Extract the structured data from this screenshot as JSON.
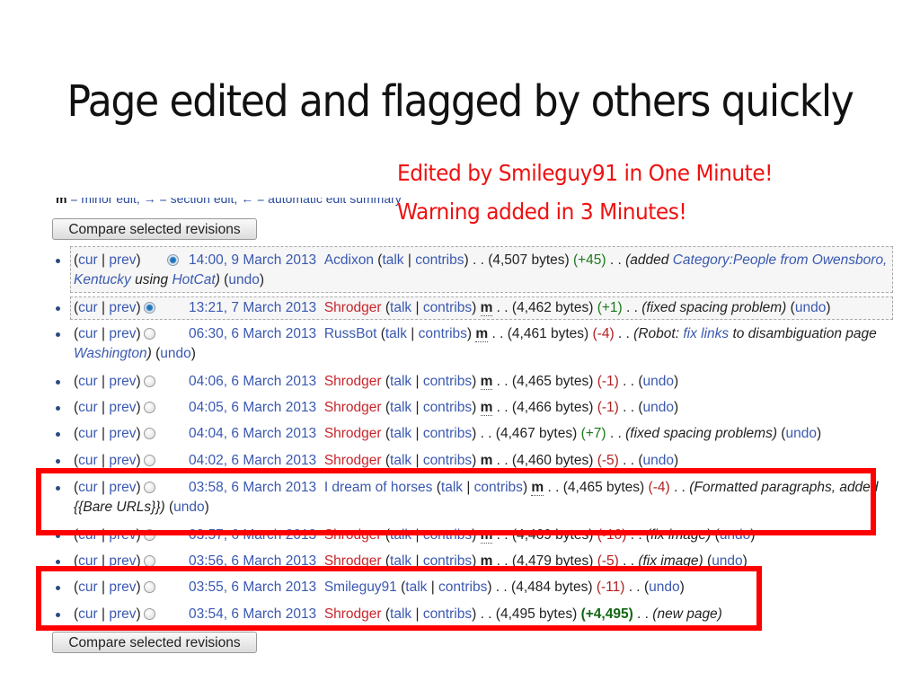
{
  "slide": {
    "title": "Page edited and flagged by others quickly",
    "annotations": [
      "Edited by Smileguy91 in One Minute!",
      "Warning added in 3  Minutes!"
    ],
    "accent_color": "#ff0000"
  },
  "history": {
    "legend": {
      "minor_abbr": "m",
      "text": " = minor edit, → = section edit, ← = automatic edit summary"
    },
    "compare_button_label": "Compare selected revisions",
    "revisions": [
      {
        "cur": "cur",
        "prev": "prev",
        "selected": true,
        "date": "14:00, 9 March 2013",
        "user": "Acdixon",
        "user_style": "blue",
        "talk": "talk",
        "contribs": "contribs",
        "minor": false,
        "size": "(4,507 bytes)",
        "diff": "(+45)",
        "diff_sign": "pos",
        "comment_pre": "(added ",
        "comment_link": "Category:People from Owensboro, Kentucky",
        "comment_post": " using ",
        "comment_link2": "HotCat",
        "comment_end": ")",
        "undo": "undo"
      },
      {
        "cur": "cur",
        "prev": "prev",
        "selected": true,
        "date": "13:21, 7 March 2013",
        "user": "Shrodger",
        "user_style": "red",
        "talk": "talk",
        "contribs": "contribs",
        "minor": true,
        "size": "(4,462 bytes)",
        "diff": "(+1)",
        "diff_sign": "pos",
        "comment": "(fixed spacing problem)",
        "undo": "undo"
      },
      {
        "cur": "cur",
        "prev": "prev",
        "selected": false,
        "date": "06:30, 6 March 2013",
        "user": "RussBot",
        "user_style": "blue",
        "talk": "talk",
        "contribs": "contribs",
        "minor": true,
        "size": "(4,461 bytes)",
        "diff": "(-4)",
        "diff_sign": "neg",
        "comment_pre": "(Robot: ",
        "comment_link": "fix links",
        "comment_post": " to disambiguation page ",
        "comment_link2": "Washington",
        "comment_end": ")",
        "undo": "undo"
      },
      {
        "cur": "cur",
        "prev": "prev",
        "selected": false,
        "date": "04:06, 6 March 2013",
        "user": "Shrodger",
        "user_style": "red",
        "talk": "talk",
        "contribs": "contribs",
        "minor": true,
        "size": "(4,465 bytes)",
        "diff": "(-1)",
        "diff_sign": "neg",
        "undo": "undo"
      },
      {
        "cur": "cur",
        "prev": "prev",
        "selected": false,
        "date": "04:05, 6 March 2013",
        "user": "Shrodger",
        "user_style": "red",
        "talk": "talk",
        "contribs": "contribs",
        "minor": true,
        "size": "(4,466 bytes)",
        "diff": "(-1)",
        "diff_sign": "neg",
        "undo": "undo"
      },
      {
        "cur": "cur",
        "prev": "prev",
        "selected": false,
        "date": "04:04, 6 March 2013",
        "user": "Shrodger",
        "user_style": "red",
        "talk": "talk",
        "contribs": "contribs",
        "minor": false,
        "size": "(4,467 bytes)",
        "diff": "(+7)",
        "diff_sign": "pos",
        "comment": "(fixed spacing problems)",
        "undo": "undo"
      },
      {
        "cur": "cur",
        "prev": "prev",
        "selected": false,
        "date": "04:02, 6 March 2013",
        "user": "Shrodger",
        "user_style": "red",
        "talk": "talk",
        "contribs": "contribs",
        "minor": true,
        "size": "(4,460 bytes)",
        "diff": "(-5)",
        "diff_sign": "neg",
        "undo": "undo"
      },
      {
        "cur": "cur",
        "prev": "prev",
        "selected": false,
        "date": "03:58, 6 March 2013",
        "user": "I dream of horses",
        "user_style": "blue",
        "talk": "talk",
        "contribs": "contribs",
        "minor": true,
        "size": "(4,465 bytes)",
        "diff": "(-4)",
        "diff_sign": "neg",
        "comment": "(Formatted paragraphs, added {{Bare URLs}})",
        "undo": "undo"
      },
      {
        "cur": "cur",
        "prev": "prev",
        "selected": false,
        "date": "03:57, 6 March 2013",
        "user": "Shrodger",
        "user_style": "red",
        "talk": "talk",
        "contribs": "contribs",
        "minor": true,
        "size": "(4,469 bytes)",
        "diff": "(-10)",
        "diff_sign": "neg",
        "comment": "(fix image)",
        "undo": "undo"
      },
      {
        "cur": "cur",
        "prev": "prev",
        "selected": false,
        "date": "03:56, 6 March 2013",
        "user": "Shrodger",
        "user_style": "red",
        "talk": "talk",
        "contribs": "contribs",
        "minor": true,
        "size": "(4,479 bytes)",
        "diff": "(-5)",
        "diff_sign": "neg",
        "comment": "(fix image)",
        "undo": "undo"
      },
      {
        "cur": "cur",
        "prev": "prev",
        "selected": false,
        "date": "03:55, 6 March 2013",
        "user": "Smileguy91",
        "user_style": "blue",
        "talk": "talk",
        "contribs": "contribs",
        "minor": false,
        "size": "(4,484 bytes)",
        "diff": "(-11)",
        "diff_sign": "neg",
        "undo": "undo"
      },
      {
        "cur": "cur",
        "prev": "prev",
        "selected": false,
        "date": "03:54, 6 March 2013",
        "user": "Shrodger",
        "user_style": "red",
        "talk": "talk",
        "contribs": "contribs",
        "minor": false,
        "size": "(4,495 bytes)",
        "diff": "(+4,495)",
        "diff_sign": "pos-big",
        "comment": "(new page)"
      }
    ]
  }
}
